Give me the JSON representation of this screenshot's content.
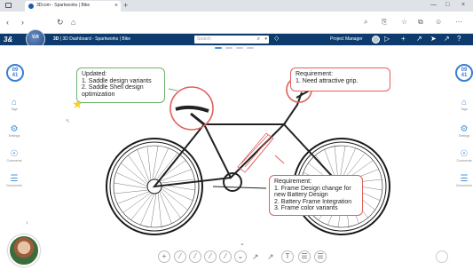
{
  "browser": {
    "tab_title": "3Dcom - Sparkworks | Bike",
    "tab_close": "×",
    "new_tab": "+",
    "window_controls": [
      "—",
      "□",
      "×"
    ],
    "nav": {
      "back": "‹",
      "forward": "›",
      "reload": "↻",
      "home": "⌂"
    },
    "toolbar_icons": [
      "⌕",
      "⎘",
      "☆",
      "⧉",
      "☺",
      "⋯"
    ]
  },
  "app": {
    "brand": "3&",
    "compass_label": "V.R",
    "title_prefix": "3D",
    "title_text": "| 3D Dashboard - Sparkworks | Bike",
    "search_placeholder": "Search",
    "search_dropdown": "▾",
    "search_icon": "⌕",
    "tag_icon": "◇",
    "manager_label": "Project Manager",
    "header_icons": [
      "▷",
      "+",
      "↗",
      "➤",
      "↗",
      "?"
    ]
  },
  "sidebar": {
    "date_number_top": "09",
    "date_number_bottom": "41",
    "items": [
      {
        "icon": "tag-icon",
        "glyph": "⌂",
        "label": "Tags"
      },
      {
        "icon": "gear-icon",
        "glyph": "⚙",
        "label": "Settings"
      },
      {
        "icon": "info-icon",
        "glyph": "☉",
        "label": "Comments"
      },
      {
        "icon": "doc-icon",
        "glyph": "☰",
        "label": "Documents"
      }
    ],
    "expand": "›"
  },
  "annotations": {
    "green": "Updated:\n1. Saddle design variants\n2. Saddle Shell design\noptimization",
    "red_grip": "Requirement:\n1. Need attractive grip.",
    "red_frame": "Requirement:\n1. Frame Design change for\nnew Battery Design\n2. Battery Frame Integration\n3. Frame color variants"
  },
  "bottom_toolbar": {
    "chevron": "⌄",
    "buttons": [
      "+",
      "⁄",
      "⁄",
      "⁄",
      "⁄",
      "⌄",
      "↗",
      "↗",
      "T",
      "☰",
      "☰"
    ]
  },
  "colors": {
    "app_header": "#0d3b6e",
    "accent": "#3a7fd0",
    "note_green": "#6db36d",
    "note_red": "#e0605a",
    "star": "#f6d21c"
  }
}
